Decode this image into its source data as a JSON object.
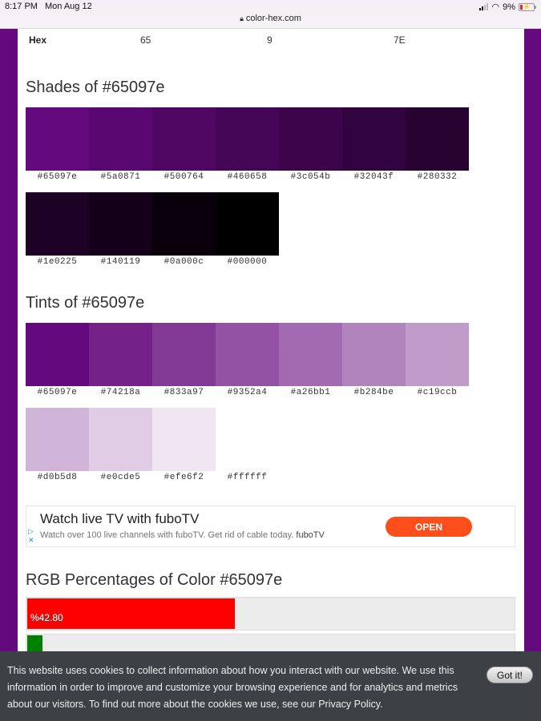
{
  "status_bar": {
    "time": "8:17 PM",
    "date": "Mon Aug 12",
    "battery": "9%",
    "url": "color-hex.com"
  },
  "hex_row": {
    "label": "Hex",
    "values": [
      "65",
      "9",
      "7E"
    ]
  },
  "shades": {
    "title": "Shades of #65097e",
    "swatches": [
      {
        "hex": "#65097e",
        "label": "#65097e"
      },
      {
        "hex": "#5a0871",
        "label": "#5a0871"
      },
      {
        "hex": "#500764",
        "label": "#500764"
      },
      {
        "hex": "#460658",
        "label": "#460658"
      },
      {
        "hex": "#3c054b",
        "label": "#3c054b"
      },
      {
        "hex": "#32043f",
        "label": "#32043f"
      },
      {
        "hex": "#280332",
        "label": "#280332"
      },
      {
        "hex": "#1e0225",
        "label": "#1e0225"
      },
      {
        "hex": "#140119",
        "label": "#140119"
      },
      {
        "hex": "#0a000c",
        "label": "#0a000c"
      },
      {
        "hex": "#000000",
        "label": "#000000"
      }
    ]
  },
  "tints": {
    "title": "Tints of #65097e",
    "swatches": [
      {
        "hex": "#65097e",
        "label": "#65097e"
      },
      {
        "hex": "#74218a",
        "label": "#74218a"
      },
      {
        "hex": "#833a97",
        "label": "#833a97"
      },
      {
        "hex": "#9352a4",
        "label": "#9352a4"
      },
      {
        "hex": "#a26bb1",
        "label": "#a26bb1"
      },
      {
        "hex": "#b284be",
        "label": "#b284be"
      },
      {
        "hex": "#c19ccb",
        "label": "#c19ccb"
      },
      {
        "hex": "#d0b5d8",
        "label": "#d0b5d8"
      },
      {
        "hex": "#e0cde5",
        "label": "#e0cde5"
      },
      {
        "hex": "#efe6f2",
        "label": "#efe6f2"
      },
      {
        "hex": "#ffffff",
        "label": "#ffffff"
      }
    ]
  },
  "ad": {
    "title": "Watch live TV with fuboTV",
    "description": "Watch over 100 live channels with fuboTV. Get rid of cable today.",
    "brand": "fuboTV",
    "button": "OPEN",
    "adchoices_icon": "▷",
    "close_icon": "✕",
    "button_color": "#fe4e1c"
  },
  "rgb_percentages": {
    "title": "RGB Percentages of Color #65097e",
    "bars": [
      {
        "channel": "red",
        "percent": 42.8,
        "label": "%42.80",
        "color": "#ff0000"
      },
      {
        "channel": "green",
        "percent": 3.53,
        "label": "",
        "color": "#008000"
      }
    ]
  },
  "cookie_banner": {
    "text": "This website uses cookies to collect information about how you interact with our website. We use this information in order to improve and customize your browsing experience and for analytics and metrics about our visitors. To find out more about the cookies we use, see our ",
    "link": "Privacy Policy",
    "suffix": ".",
    "button": "Got it!"
  },
  "colors": {
    "page_border": "#65097e",
    "cookie_bg": "#3d4145"
  }
}
